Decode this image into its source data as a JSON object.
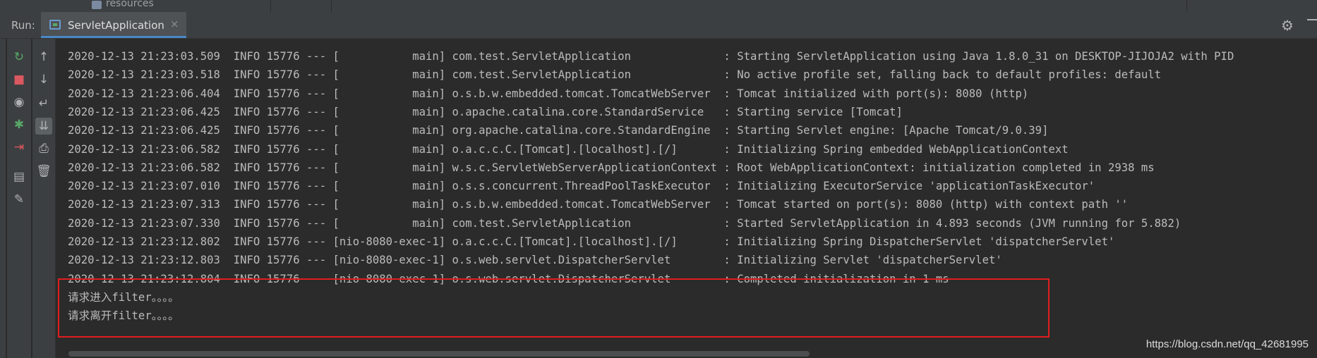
{
  "top_strip": {
    "resources_label": "resources"
  },
  "run_bar": {
    "run_label": "Run:",
    "tab_label": "ServletApplication",
    "tab_close": "×"
  },
  "left_toolbar": [
    {
      "icon": "rerun-icon",
      "glyph": "↻"
    },
    {
      "icon": "stop-icon",
      "glyph": "■"
    },
    {
      "icon": "camera-icon",
      "glyph": "◉"
    },
    {
      "icon": "debug-icon",
      "glyph": "✱"
    },
    {
      "icon": "exit-icon",
      "glyph": "⇥"
    },
    {
      "icon": "layout-icon",
      "glyph": "▤"
    },
    {
      "icon": "pin-icon",
      "glyph": "✎"
    }
  ],
  "right_toolbar": [
    {
      "icon": "arrow-up-icon",
      "glyph": "↑"
    },
    {
      "icon": "arrow-down-icon",
      "glyph": "↓"
    },
    {
      "icon": "soft-wrap-icon",
      "glyph": "↵"
    },
    {
      "icon": "scroll-to-end-icon",
      "glyph": "⇊"
    },
    {
      "icon": "print-icon",
      "glyph": "⎙"
    },
    {
      "icon": "trash-icon",
      "glyph": "🗑"
    }
  ],
  "console_lines": [
    "2020-12-13 21:23:03.509  INFO 15776 --- [           main] com.test.ServletApplication              : Starting ServletApplication using Java 1.8.0_31 on DESKTOP-JIJOJA2 with PID",
    "2020-12-13 21:23:03.518  INFO 15776 --- [           main] com.test.ServletApplication              : No active profile set, falling back to default profiles: default",
    "2020-12-13 21:23:06.404  INFO 15776 --- [           main] o.s.b.w.embedded.tomcat.TomcatWebServer  : Tomcat initialized with port(s): 8080 (http)",
    "2020-12-13 21:23:06.425  INFO 15776 --- [           main] o.apache.catalina.core.StandardService   : Starting service [Tomcat]",
    "2020-12-13 21:23:06.425  INFO 15776 --- [           main] org.apache.catalina.core.StandardEngine  : Starting Servlet engine: [Apache Tomcat/9.0.39]",
    "2020-12-13 21:23:06.582  INFO 15776 --- [           main] o.a.c.c.C.[Tomcat].[localhost].[/]       : Initializing Spring embedded WebApplicationContext",
    "2020-12-13 21:23:06.582  INFO 15776 --- [           main] w.s.c.ServletWebServerApplicationContext : Root WebApplicationContext: initialization completed in 2938 ms",
    "2020-12-13 21:23:07.010  INFO 15776 --- [           main] o.s.s.concurrent.ThreadPoolTaskExecutor  : Initializing ExecutorService 'applicationTaskExecutor'",
    "2020-12-13 21:23:07.313  INFO 15776 --- [           main] o.s.b.w.embedded.tomcat.TomcatWebServer  : Tomcat started on port(s): 8080 (http) with context path ''",
    "2020-12-13 21:23:07.330  INFO 15776 --- [           main] com.test.ServletApplication              : Started ServletApplication in 4.893 seconds (JVM running for 5.882)",
    "2020-12-13 21:23:12.802  INFO 15776 --- [nio-8080-exec-1] o.a.c.c.C.[Tomcat].[localhost].[/]       : Initializing Spring DispatcherServlet 'dispatcherServlet'",
    "2020-12-13 21:23:12.803  INFO 15776 --- [nio-8080-exec-1] o.s.web.servlet.DispatcherServlet        : Initializing Servlet 'dispatcherServlet'",
    "2020-12-13 21:23:12.804  INFO 15776 --- [nio-8080-exec-1] o.s.web.servlet.DispatcherServlet        : Completed initialization in 1 ms",
    "请求进入filter。。。。",
    "请求离开filter。。。。"
  ],
  "watermark": "https://blog.csdn.net/qq_42681995",
  "colors": {
    "background": "#2b2b2b",
    "panel": "#3c3f41",
    "text": "#bbbbbb",
    "highlight_border": "#e01e1e",
    "tab_underline": "#4a88c7"
  }
}
